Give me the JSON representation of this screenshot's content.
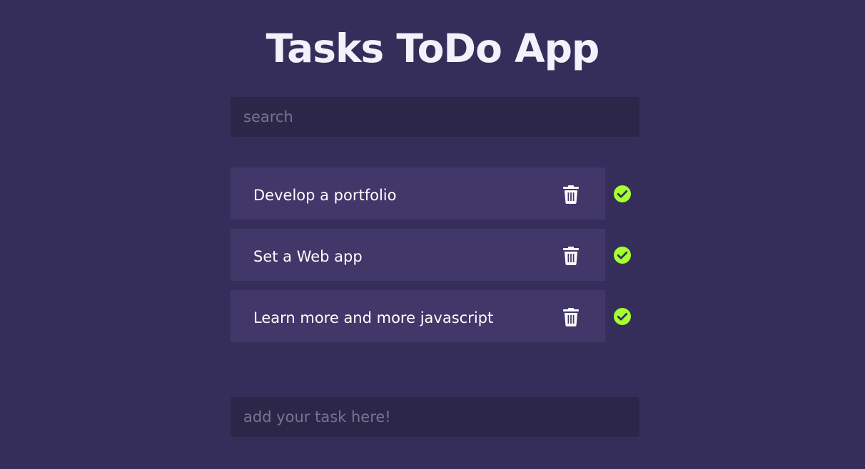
{
  "app": {
    "title": "Tasks ToDo App"
  },
  "search": {
    "placeholder": "search",
    "value": ""
  },
  "tasks": [
    {
      "label": "Develop a portfolio"
    },
    {
      "label": "Set a Web app"
    },
    {
      "label": "Learn more and more javascript"
    }
  ],
  "add_task": {
    "placeholder": "add your task here!",
    "value": ""
  },
  "icons": {
    "delete": "trash-icon",
    "complete": "check-circle-icon"
  },
  "colors": {
    "background": "#352e5a",
    "card": "#413769",
    "input": "#2c2749",
    "check": "#a6ff2e"
  }
}
